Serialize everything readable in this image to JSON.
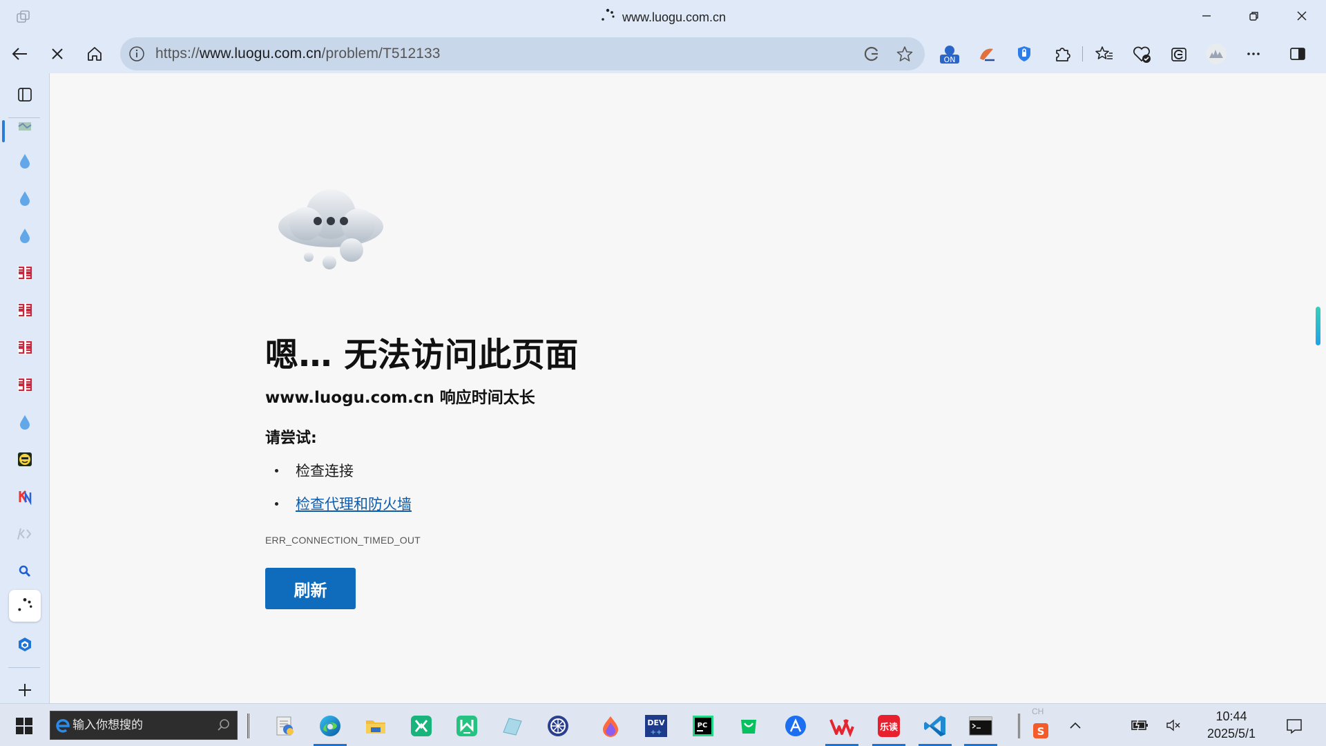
{
  "window": {
    "title": "www.luogu.com.cn"
  },
  "addressbar": {
    "scheme": "https://",
    "host": "www.luogu.com.cn",
    "path": "/problem/T512133"
  },
  "extensions": {
    "on_badge": "ON"
  },
  "error_page": {
    "heading": "嗯… 无法访问此页面",
    "subheading": "www.luogu.com.cn 响应时间太长",
    "try_label": "请尝试:",
    "suggestions": [
      "检查连接",
      "检查代理和防火墙"
    ],
    "error_code": "ERR_CONNECTION_TIMED_OUT",
    "refresh_label": "刷新"
  },
  "taskbar": {
    "search_placeholder": "输入你想搜的",
    "ime": "CH",
    "clock_time": "10:44",
    "clock_date": "2025/5/1",
    "apps": [
      "file-explorer-doc",
      "edge",
      "file-explorer",
      "mindmaster",
      "mindmaster-green",
      "notepad",
      "steam",
      "paint",
      "dev-cpp",
      "pycharm",
      "wechat-store",
      "arc",
      "wps",
      "ledu",
      "vscode",
      "terminal"
    ],
    "ledu_label": "乐读",
    "devcpp_label": "DEV",
    "pycharm_label": "PC"
  },
  "colors": {
    "chrome_bg": "#dfe9f8",
    "page_bg": "#f7f7f7",
    "accent": "#0f6cbd",
    "link": "#0b5cad"
  }
}
